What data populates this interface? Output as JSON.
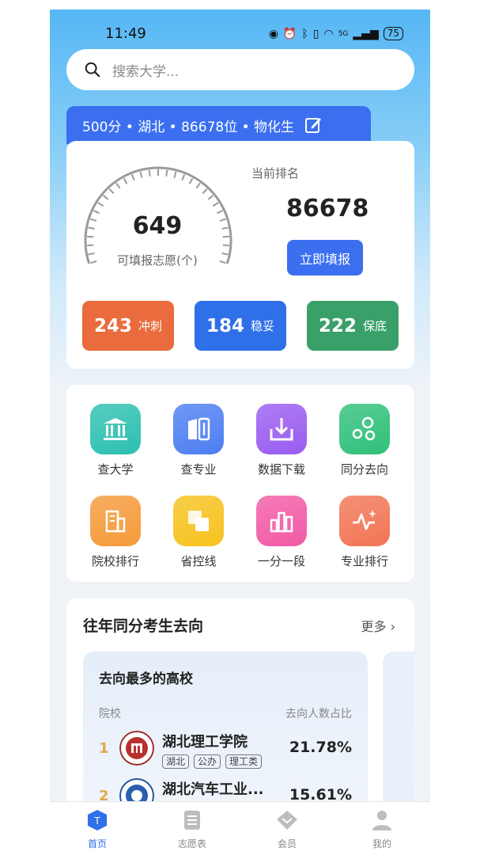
{
  "status": {
    "time": "11:49",
    "network": "5G",
    "battery": "75"
  },
  "search": {
    "placeholder": "搜索大学..."
  },
  "profile": {
    "summary": "500分 • 湖北 • 86678位 • 物化生"
  },
  "summary": {
    "volunteer_count": "649",
    "volunteer_label": "可填报志愿(个)",
    "rank_label": "当前排名",
    "rank_value": "86678",
    "fill_button": "立即填报",
    "tiers": [
      {
        "count": "243",
        "label": "冲刺",
        "color": "#ea6b3d"
      },
      {
        "count": "184",
        "label": "稳妥",
        "color": "#2f6fe8"
      },
      {
        "count": "222",
        "label": "保底",
        "color": "#3aa06a"
      }
    ]
  },
  "tools": [
    {
      "label": "查大学",
      "icon": "university-icon",
      "color": "#2cc0b0"
    },
    {
      "label": "查专业",
      "icon": "major-icon",
      "color": "#4d7ef2"
    },
    {
      "label": "数据下载",
      "icon": "download-icon",
      "color": "#9a5cf0"
    },
    {
      "label": "同分去向",
      "icon": "bubbles-icon",
      "color": "#2fc07a"
    },
    {
      "label": "院校排行",
      "icon": "building-icon",
      "color": "#f59a3a"
    },
    {
      "label": "省控线",
      "icon": "layers-icon",
      "color": "#f7c21e"
    },
    {
      "label": "一分一段",
      "icon": "bar-chart-icon",
      "color": "#f25aa6"
    },
    {
      "label": "专业排行",
      "icon": "pulse-icon",
      "color": "#f27555"
    }
  ],
  "destinations": {
    "title": "往年同分考生去向",
    "more": "更多",
    "card_title": "去向最多的高校",
    "col_school": "院校",
    "col_ratio": "去向人数占比",
    "rows": [
      {
        "rank": "1",
        "name": "湖北理工学院",
        "tags": [
          "湖北",
          "公办",
          "理工类"
        ],
        "ratio": "21.78%"
      },
      {
        "rank": "2",
        "name": "湖北汽车工业...",
        "tags": [],
        "ratio": "15.61%"
      }
    ]
  },
  "tabbar": [
    {
      "label": "首页",
      "active": true
    },
    {
      "label": "志愿表",
      "active": false
    },
    {
      "label": "会员",
      "active": false
    },
    {
      "label": "我的",
      "active": false
    }
  ]
}
